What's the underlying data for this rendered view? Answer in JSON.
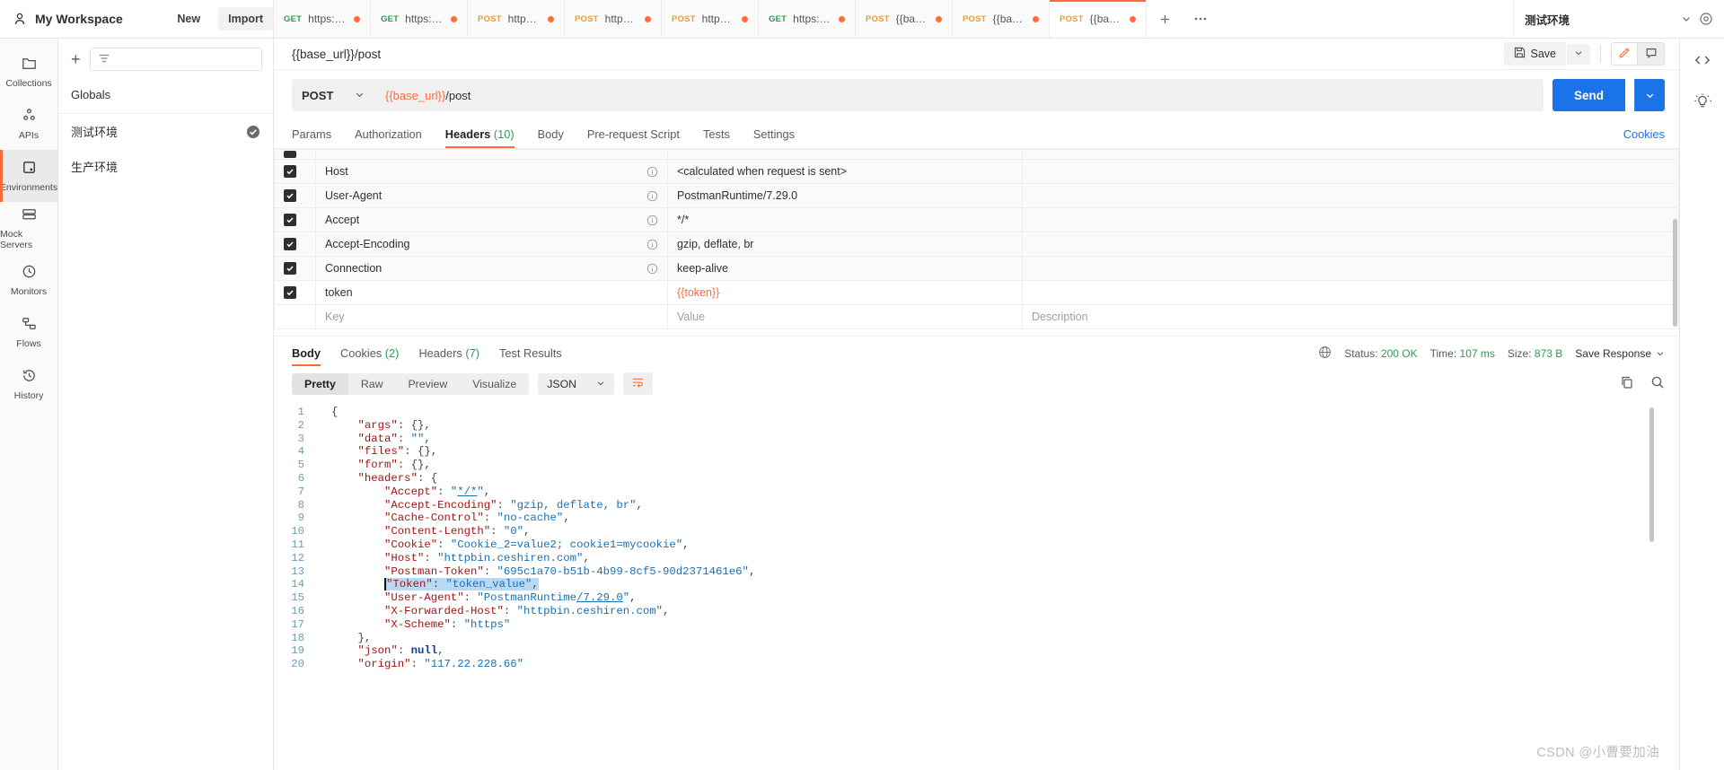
{
  "topbar": {
    "workspace": "My Workspace",
    "new_label": "New",
    "import_label": "Import",
    "add_tab_icon": "plus-icon",
    "more_tabs_icon": "ellipsis-icon",
    "environment": "测试环境",
    "env_caret_icon": "chevron-down-icon",
    "env_eye_icon": "eye-icon",
    "tabs": [
      {
        "method": "GET",
        "url": "https://ces…",
        "unsaved": true,
        "active": false
      },
      {
        "method": "GET",
        "url": "https://htt…",
        "unsaved": true,
        "active": false
      },
      {
        "method": "POST",
        "url": "https://ht…",
        "unsaved": true,
        "active": false
      },
      {
        "method": "POST",
        "url": "https://ht…",
        "unsaved": true,
        "active": false
      },
      {
        "method": "POST",
        "url": "https://ht…",
        "unsaved": true,
        "active": false
      },
      {
        "method": "GET",
        "url": "https://htt…",
        "unsaved": true,
        "active": false
      },
      {
        "method": "POST",
        "url": "{{base_ur…",
        "unsaved": true,
        "active": false
      },
      {
        "method": "POST",
        "url": "{{base_ur…",
        "unsaved": true,
        "active": false
      },
      {
        "method": "POST",
        "url": "{{base_ur…",
        "unsaved": true,
        "active": true
      }
    ]
  },
  "rail": {
    "items": [
      {
        "label": "Collections",
        "icon": "collections-icon",
        "active": false
      },
      {
        "label": "APIs",
        "icon": "apis-icon",
        "active": false
      },
      {
        "label": "Environments",
        "icon": "environments-icon",
        "active": true
      },
      {
        "label": "Mock Servers",
        "icon": "mock-servers-icon",
        "active": false
      },
      {
        "label": "Monitors",
        "icon": "monitors-icon",
        "active": false
      },
      {
        "label": "Flows",
        "icon": "flows-icon",
        "active": false
      },
      {
        "label": "History",
        "icon": "history-icon",
        "active": false
      }
    ]
  },
  "sidebar": {
    "add_icon": "plus-icon",
    "filter_icon": "filter-icon",
    "filter_placeholder": "",
    "globals_label": "Globals",
    "environments": [
      {
        "name": "测试环境",
        "selected": true
      },
      {
        "name": "生产环境",
        "selected": false
      }
    ],
    "selected_icon": "check-circle-icon"
  },
  "request": {
    "name": "{{base_url}}/post",
    "save_label": "Save",
    "save_icon": "floppy-icon",
    "save_caret_icon": "chevron-down-icon",
    "edit_icon": "pencil-icon",
    "comment_icon": "comment-icon",
    "method": "POST",
    "method_caret_icon": "chevron-down-icon",
    "url_var": "{{base_url}}",
    "url_rest": "/post",
    "send_label": "Send",
    "send_caret_icon": "chevron-down-icon",
    "cookies_link": "Cookies",
    "tabs": [
      {
        "label": "Params",
        "count": "",
        "active": false
      },
      {
        "label": "Authorization",
        "count": "",
        "active": false
      },
      {
        "label": "Headers",
        "count": "(10)",
        "active": true
      },
      {
        "label": "Body",
        "count": "",
        "active": false
      },
      {
        "label": "Pre-request Script",
        "count": "",
        "active": false
      },
      {
        "label": "Tests",
        "count": "",
        "active": false
      },
      {
        "label": "Settings",
        "count": "",
        "active": false
      }
    ]
  },
  "headers_table": {
    "info_icon": "info-icon",
    "check_icon": "check-icon",
    "placeholder_key": "Key",
    "placeholder_value": "Value",
    "placeholder_desc": "Description",
    "rows": [
      {
        "checked": true,
        "key": "Host",
        "value": "<calculated when request is sent>",
        "desc": "",
        "info": true,
        "value_is_var": false
      },
      {
        "checked": true,
        "key": "User-Agent",
        "value": "PostmanRuntime/7.29.0",
        "desc": "",
        "info": true,
        "value_is_var": false
      },
      {
        "checked": true,
        "key": "Accept",
        "value": "*/*",
        "desc": "",
        "info": true,
        "value_is_var": false
      },
      {
        "checked": true,
        "key": "Accept-Encoding",
        "value": "gzip, deflate, br",
        "desc": "",
        "info": true,
        "value_is_var": false
      },
      {
        "checked": true,
        "key": "Connection",
        "value": "keep-alive",
        "desc": "",
        "info": true,
        "value_is_var": false
      },
      {
        "checked": true,
        "key": "token",
        "value": "{{token}}",
        "desc": "",
        "info": false,
        "value_is_var": true
      }
    ]
  },
  "response": {
    "tabs": [
      {
        "label": "Body",
        "count": "",
        "active": true
      },
      {
        "label": "Cookies",
        "count": "(2)",
        "active": false
      },
      {
        "label": "Headers",
        "count": "(7)",
        "active": false
      },
      {
        "label": "Test Results",
        "count": "",
        "active": false
      }
    ],
    "globe_icon": "globe-icon",
    "status_label": "Status:",
    "status_value": "200 OK",
    "time_label": "Time:",
    "time_value": "107 ms",
    "size_label": "Size:",
    "size_value": "873 B",
    "save_response_label": "Save Response",
    "save_response_caret_icon": "chevron-down-icon",
    "formats": [
      {
        "label": "Pretty",
        "active": true
      },
      {
        "label": "Raw",
        "active": false
      },
      {
        "label": "Preview",
        "active": false
      },
      {
        "label": "Visualize",
        "active": false
      }
    ],
    "language": "JSON",
    "language_caret_icon": "chevron-down-icon",
    "wrap_icon": "word-wrap-icon",
    "copy_icon": "copy-icon",
    "search_icon": "search-icon",
    "body_lines": [
      {
        "n": "1",
        "segs": [
          {
            "t": "{",
            "c": "p"
          }
        ]
      },
      {
        "n": "2",
        "segs": [
          {
            "t": "    ",
            "c": "p"
          },
          {
            "t": "\"args\"",
            "c": "k"
          },
          {
            "t": ": {},",
            "c": "p"
          }
        ]
      },
      {
        "n": "3",
        "segs": [
          {
            "t": "    ",
            "c": "p"
          },
          {
            "t": "\"data\"",
            "c": "k"
          },
          {
            "t": ": ",
            "c": "p"
          },
          {
            "t": "\"\"",
            "c": "s"
          },
          {
            "t": ",",
            "c": "p"
          }
        ]
      },
      {
        "n": "4",
        "segs": [
          {
            "t": "    ",
            "c": "p"
          },
          {
            "t": "\"files\"",
            "c": "k"
          },
          {
            "t": ": {},",
            "c": "p"
          }
        ]
      },
      {
        "n": "5",
        "segs": [
          {
            "t": "    ",
            "c": "p"
          },
          {
            "t": "\"form\"",
            "c": "k"
          },
          {
            "t": ": {},",
            "c": "p"
          }
        ]
      },
      {
        "n": "6",
        "segs": [
          {
            "t": "    ",
            "c": "p"
          },
          {
            "t": "\"headers\"",
            "c": "k"
          },
          {
            "t": ": {",
            "c": "p"
          }
        ]
      },
      {
        "n": "7",
        "segs": [
          {
            "t": "        ",
            "c": "p"
          },
          {
            "t": "\"Accept\"",
            "c": "k"
          },
          {
            "t": ": ",
            "c": "p"
          },
          {
            "t": "\"",
            "c": "s"
          },
          {
            "t": "*/*",
            "c": "s ul"
          },
          {
            "t": "\"",
            "c": "s"
          },
          {
            "t": ",",
            "c": "p"
          }
        ]
      },
      {
        "n": "8",
        "segs": [
          {
            "t": "        ",
            "c": "p"
          },
          {
            "t": "\"Accept-Encoding\"",
            "c": "k"
          },
          {
            "t": ": ",
            "c": "p"
          },
          {
            "t": "\"gzip, deflate, br\"",
            "c": "s"
          },
          {
            "t": ",",
            "c": "p"
          }
        ]
      },
      {
        "n": "9",
        "segs": [
          {
            "t": "        ",
            "c": "p"
          },
          {
            "t": "\"Cache-Control\"",
            "c": "k"
          },
          {
            "t": ": ",
            "c": "p"
          },
          {
            "t": "\"no-cache\"",
            "c": "s"
          },
          {
            "t": ",",
            "c": "p"
          }
        ]
      },
      {
        "n": "10",
        "segs": [
          {
            "t": "        ",
            "c": "p"
          },
          {
            "t": "\"Content-Length\"",
            "c": "k"
          },
          {
            "t": ": ",
            "c": "p"
          },
          {
            "t": "\"0\"",
            "c": "s"
          },
          {
            "t": ",",
            "c": "p"
          }
        ]
      },
      {
        "n": "11",
        "segs": [
          {
            "t": "        ",
            "c": "p"
          },
          {
            "t": "\"Cookie\"",
            "c": "k"
          },
          {
            "t": ": ",
            "c": "p"
          },
          {
            "t": "\"Cookie_2=value2; cookie1=mycookie\"",
            "c": "s"
          },
          {
            "t": ",",
            "c": "p"
          }
        ]
      },
      {
        "n": "12",
        "segs": [
          {
            "t": "        ",
            "c": "p"
          },
          {
            "t": "\"Host\"",
            "c": "k"
          },
          {
            "t": ": ",
            "c": "p"
          },
          {
            "t": "\"httpbin.ceshiren.com\"",
            "c": "s"
          },
          {
            "t": ",",
            "c": "p"
          }
        ]
      },
      {
        "n": "13",
        "segs": [
          {
            "t": "        ",
            "c": "p"
          },
          {
            "t": "\"Postman-Token\"",
            "c": "k"
          },
          {
            "t": ": ",
            "c": "p"
          },
          {
            "t": "\"695c1a70-b51b-4b99-8cf5-90d2371461e6\"",
            "c": "s"
          },
          {
            "t": ",",
            "c": "p"
          }
        ]
      },
      {
        "n": "14",
        "highlight": true,
        "segs": [
          {
            "t": "        ",
            "c": "p"
          },
          {
            "t": "\"Token\"",
            "c": "k hl caret-mark"
          },
          {
            "t": ": ",
            "c": "p hl"
          },
          {
            "t": "\"token_value\"",
            "c": "s hl"
          },
          {
            "t": ",",
            "c": "p hl"
          }
        ]
      },
      {
        "n": "15",
        "segs": [
          {
            "t": "        ",
            "c": "p"
          },
          {
            "t": "\"User-Agent\"",
            "c": "k"
          },
          {
            "t": ": ",
            "c": "p"
          },
          {
            "t": "\"PostmanRuntime",
            "c": "s"
          },
          {
            "t": "/7.29.0",
            "c": "s ul"
          },
          {
            "t": "\"",
            "c": "s"
          },
          {
            "t": ",",
            "c": "p"
          }
        ]
      },
      {
        "n": "16",
        "segs": [
          {
            "t": "        ",
            "c": "p"
          },
          {
            "t": "\"X-Forwarded-Host\"",
            "c": "k"
          },
          {
            "t": ": ",
            "c": "p"
          },
          {
            "t": "\"httpbin.ceshiren.com\"",
            "c": "s"
          },
          {
            "t": ",",
            "c": "p"
          }
        ]
      },
      {
        "n": "17",
        "segs": [
          {
            "t": "        ",
            "c": "p"
          },
          {
            "t": "\"X-Scheme\"",
            "c": "k"
          },
          {
            "t": ": ",
            "c": "p"
          },
          {
            "t": "\"https\"",
            "c": "s"
          }
        ]
      },
      {
        "n": "18",
        "segs": [
          {
            "t": "    },",
            "c": "p"
          }
        ]
      },
      {
        "n": "19",
        "segs": [
          {
            "t": "    ",
            "c": "p"
          },
          {
            "t": "\"json\"",
            "c": "k"
          },
          {
            "t": ": ",
            "c": "p"
          },
          {
            "t": "null",
            "c": "nul"
          },
          {
            "t": ",",
            "c": "p"
          }
        ]
      },
      {
        "n": "20",
        "segs": [
          {
            "t": "    ",
            "c": "p"
          },
          {
            "t": "\"origin\"",
            "c": "k"
          },
          {
            "t": ": ",
            "c": "p"
          },
          {
            "t": "\"117.22.228.66\"",
            "c": "s"
          }
        ]
      }
    ]
  },
  "right_rail": {
    "items": [
      {
        "icon": "code-icon"
      },
      {
        "icon": "bulb-icon"
      }
    ]
  },
  "watermark": "CSDN @小曹要加油",
  "colors": {
    "accent": "#ff6c37",
    "send": "#1a73e8",
    "ok": "#2e9b51",
    "get": "#2e9b51",
    "post": "#e79b3f"
  }
}
